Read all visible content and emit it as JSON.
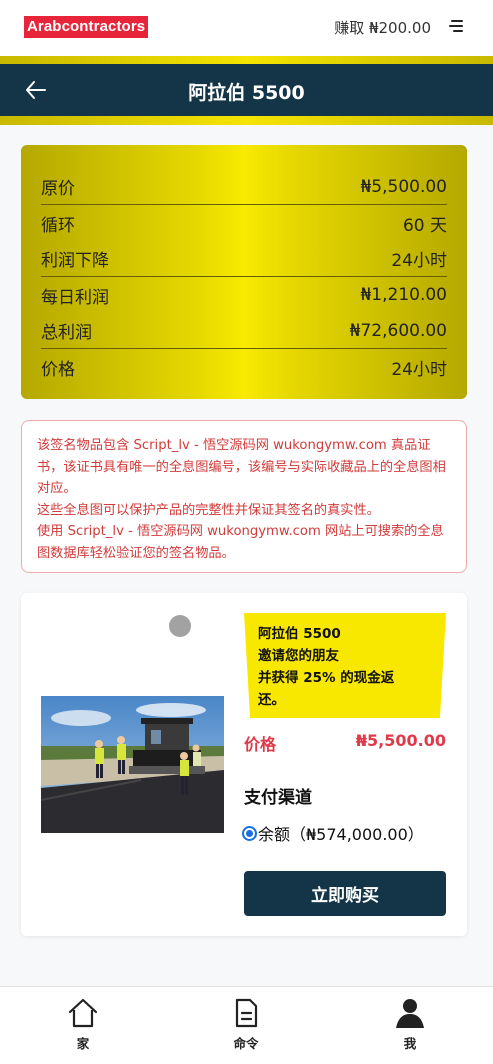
{
  "header": {
    "logo_text": "Arabcontractors",
    "earn_text": "赚取 ₦200.00",
    "menu_icon": "menu-icon"
  },
  "nav": {
    "back_icon": "arrow-left-icon",
    "title": "阿拉伯 5500"
  },
  "specs": [
    {
      "label": "原价",
      "value": "₦5,500.00"
    },
    {
      "label": "循环",
      "value": "60 天"
    },
    {
      "label": "利润下降",
      "value": "24小时"
    },
    {
      "label": "每日利润",
      "value": "₦1,210.00"
    },
    {
      "label": "总利润",
      "value": "₦72,600.00"
    },
    {
      "label": "价格",
      "value": "24小时"
    }
  ],
  "notice": {
    "text": "该签名物品包含 Script_lv - 悟空源码网 wukongymw.com 真品证书，该证书具有唯一的全息图编号，该编号与实际收藏品上的全息图相对应。\n这些全息图可以保护产品的完整性并保证其签名的真实性。\n使用 Script_lv - 悟空源码网 wukongymw.com 网站上可搜索的全息图数据库轻松验证您的签名物品。"
  },
  "product": {
    "promo_line1": "阿拉伯 5500",
    "promo_line2": "邀请您的朋友",
    "promo_line3": "并获得 25% 的现金返",
    "promo_line4": "还。",
    "price_label": "价格",
    "price_value": "₦5,500.00",
    "payment_title": "支付渠道",
    "payment_option": "余额（₦574,000.00）",
    "buy_label": "立即购买"
  },
  "tabbar": {
    "items": [
      {
        "label": "家",
        "icon": "home-icon"
      },
      {
        "label": "命令",
        "icon": "document-icon"
      },
      {
        "label": "我",
        "icon": "user-icon"
      }
    ]
  },
  "colors": {
    "navy": "#143548",
    "gold": "#f5e400",
    "accent_red": "#e03a4a",
    "logo_red": "#e8243a"
  }
}
